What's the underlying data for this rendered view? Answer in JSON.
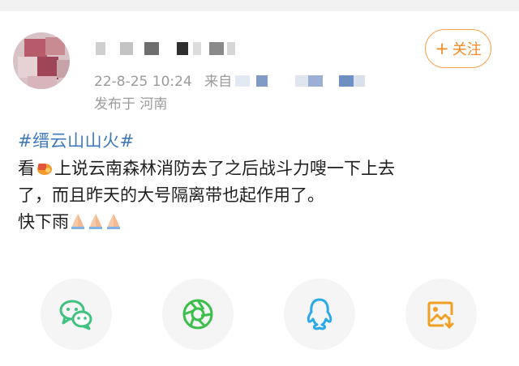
{
  "post": {
    "meta_timestamp": "22-8-25 10:24",
    "meta_source_prefix": "来自",
    "location": "发布于 河南",
    "follow_plus": "+",
    "follow_label": "关注",
    "topic": "#缙云山山火#",
    "line1_a": "看",
    "line1_b": "上说云南森林消防去了之后战斗力嗖一下上去",
    "line2": "了，而且昨天的大号隔离带也起作用了。",
    "line3": "快下雨"
  },
  "share": {
    "items": [
      {
        "icon": "wechat-icon"
      },
      {
        "icon": "moments-icon"
      },
      {
        "icon": "qq-icon"
      },
      {
        "icon": "save-image-icon"
      }
    ]
  },
  "colors": {
    "follow_orange": "#f08a24",
    "topic_blue": "#3f79b8",
    "meta_gray": "#9b9b9b",
    "wechat_green": "#3fc17f",
    "moments_green": "#3bbf4a",
    "qq_blue": "#2aa8e8",
    "save_orange": "#f2a024"
  }
}
